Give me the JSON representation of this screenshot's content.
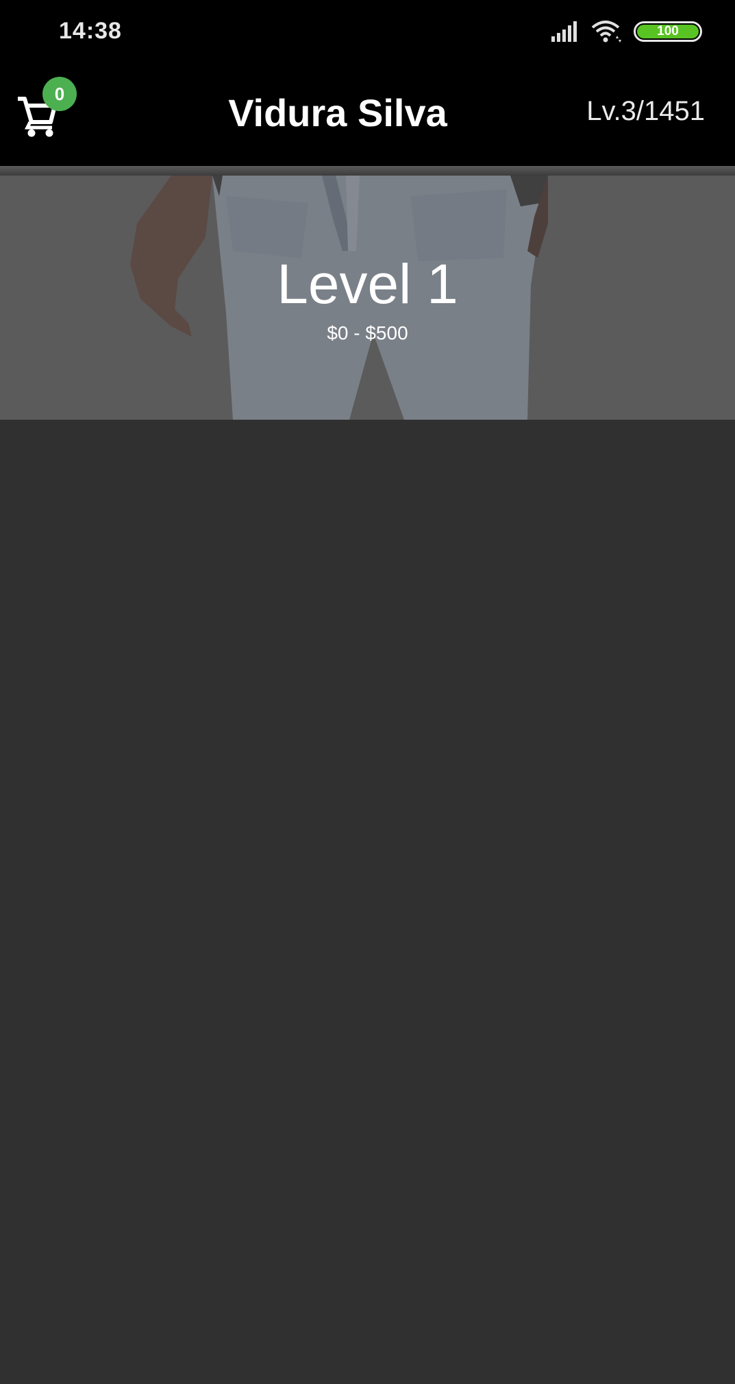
{
  "status_bar": {
    "time": "14:38",
    "battery": "100",
    "icons": [
      "signal-icon",
      "wifi-icon",
      "battery-icon"
    ]
  },
  "app_bar": {
    "title": "Vidura Silva",
    "cart_count": "0",
    "level": "Lv.3/1451",
    "cart_icon": "cart-icon",
    "badge_color": "#4caf50"
  },
  "banner": {
    "title": "Level 1",
    "range": "$0 - $500"
  },
  "colors": {
    "background": "#303030",
    "app_bar": "#000000",
    "battery": "#58c322"
  }
}
